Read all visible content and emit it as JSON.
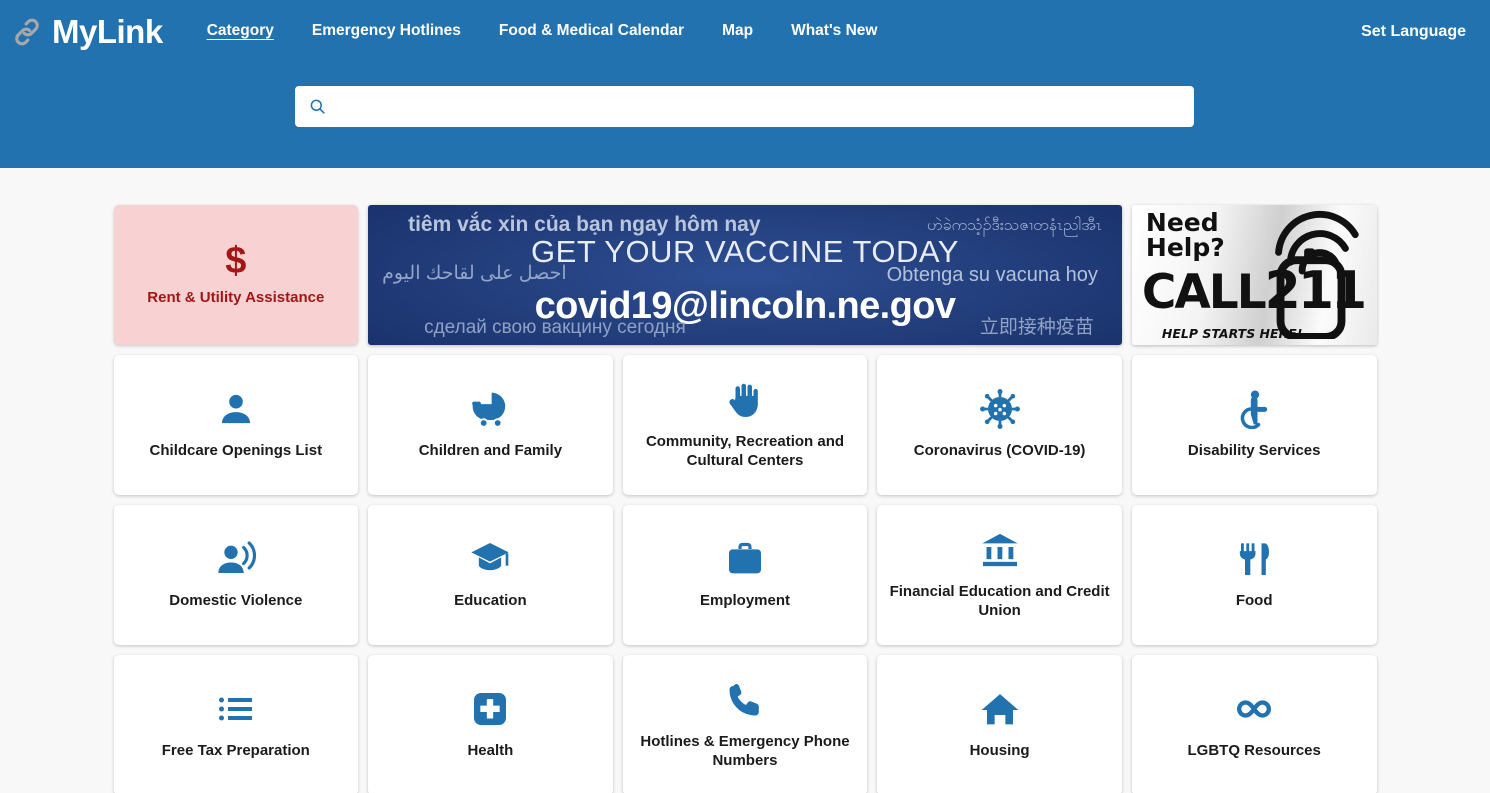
{
  "theme": {
    "header_blue": "#2272b0",
    "icon_blue": "#2272b0",
    "page_bg": "#f8f8f8",
    "rent_bg": "#f8d2d2",
    "rent_fg": "#a31616"
  },
  "header": {
    "brand": "MyLink",
    "brand_icon": "link-chain-icon",
    "nav": [
      {
        "label": "Category",
        "active": true
      },
      {
        "label": "Emergency Hotlines",
        "active": false
      },
      {
        "label": "Food & Medical Calendar",
        "active": false
      },
      {
        "label": "Map",
        "active": false
      },
      {
        "label": "What's New",
        "active": false
      }
    ],
    "set_language": "Set Language"
  },
  "search": {
    "icon": "search-icon",
    "value": "",
    "placeholder": ""
  },
  "promos": {
    "rent": {
      "icon": "dollar-sign-icon",
      "symbol": "$",
      "label": "Rent & Utility Assistance"
    },
    "vaccine_banner": {
      "headline": "GET YOUR VACCINE TODAY",
      "email": "covid19@lincoln.ne.gov",
      "vietnamese": "tiêm vắc xin của bạn ngay hôm nay",
      "burmese": "ဟဲခဲကသံ့ၣ်ဒီးသဇၢတနံၤညါအီၤ",
      "arabic": "احصل على لقاحك اليوم",
      "spanish": "Obtenga su vacuna hoy",
      "russian": "сделай свою вакцину сегодня",
      "chinese": "立即接种疫苗"
    },
    "call211_banner": {
      "need": "Need",
      "help": "Help?",
      "call": "CALL",
      "number": "211",
      "tagline": "HELP STARTS HERE!",
      "icon": "phone-signal-icon"
    }
  },
  "categories": [
    {
      "label": "Childcare Openings List",
      "icon": "person-icon"
    },
    {
      "label": "Children and Family",
      "icon": "baby-carriage-icon"
    },
    {
      "label": "Community, Recreation and Cultural Centers",
      "icon": "raised-hand-icon"
    },
    {
      "label": "Coronavirus (COVID-19)",
      "icon": "virus-icon"
    },
    {
      "label": "Disability Services",
      "icon": "wheelchair-icon"
    },
    {
      "label": "Domestic Violence",
      "icon": "person-speaking-icon"
    },
    {
      "label": "Education",
      "icon": "graduation-cap-icon"
    },
    {
      "label": "Employment",
      "icon": "briefcase-icon"
    },
    {
      "label": "Financial Education and Credit Union",
      "icon": "bank-icon"
    },
    {
      "label": "Food",
      "icon": "fork-knife-icon"
    },
    {
      "label": "Free Tax Preparation",
      "icon": "list-icon"
    },
    {
      "label": "Health",
      "icon": "medical-cross-icon"
    },
    {
      "label": "Hotlines & Emergency Phone Numbers",
      "icon": "phone-icon"
    },
    {
      "label": "Housing",
      "icon": "house-icon"
    },
    {
      "label": "LGBTQ Resources",
      "icon": "infinity-icon"
    }
  ]
}
